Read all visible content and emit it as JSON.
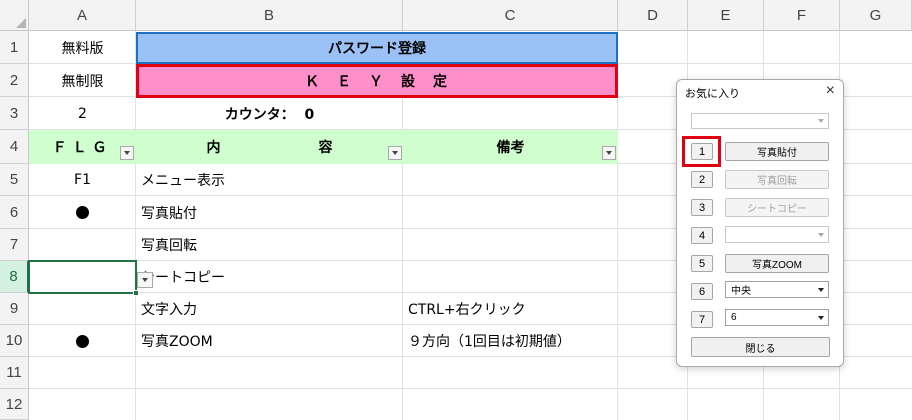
{
  "columns": [
    "A",
    "B",
    "C",
    "D",
    "E",
    "F",
    "G"
  ],
  "rows": [
    "1",
    "2",
    "3",
    "4",
    "5",
    "6",
    "7",
    "8",
    "9",
    "10",
    "11",
    "12"
  ],
  "cells": {
    "a1": "無料版",
    "b1": "パスワード登録",
    "a2": "無制限",
    "b2": "Ｋ　Ｅ　Ｙ　設　定",
    "a3": "2",
    "b3": "カウンタ：  0",
    "a4": "ＦＬＧ",
    "b4": "内　　　　　　　容",
    "c4": "備考",
    "a5": "F1",
    "b5": "メニュー表示",
    "b6": "写真貼付",
    "b7": "写真回転",
    "b8": "シートコピー",
    "b9": "文字入力",
    "c9": "CTRL+右クリック",
    "b10": "写真ZOOM",
    "c10": "９方向（1回目は初期値）"
  },
  "marks": {
    "row6_flag": "●",
    "row10_flag": "●"
  },
  "selected_cell": "A8",
  "dialog": {
    "title": "お気に入り",
    "close": "×",
    "top_combo": "",
    "buttons": [
      {
        "num": "1",
        "label": "写真貼付",
        "enabled": true
      },
      {
        "num": "2",
        "label": "写真回転",
        "enabled": false
      },
      {
        "num": "3",
        "label": "シートコピー",
        "enabled": false
      },
      {
        "num": "4",
        "label": "",
        "enabled": false
      },
      {
        "num": "5",
        "label": "写真ZOOM",
        "enabled": true
      },
      {
        "num": "6",
        "label": "中央",
        "enabled": true
      },
      {
        "num": "7",
        "label": "6",
        "enabled": true
      }
    ],
    "close_button": "閉じる"
  },
  "colors": {
    "password_fill": "#9bc2f7",
    "key_fill": "#ff8fc8",
    "header_fill": "#cfffcf",
    "highlight_red": "#e00010",
    "excel_green": "#217346"
  }
}
